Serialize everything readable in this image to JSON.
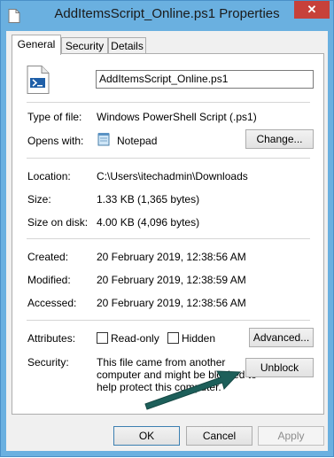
{
  "window": {
    "title": "AddItemsScript_Online.ps1 Properties",
    "close_glyph": "✕"
  },
  "tabs": [
    {
      "label": "General"
    },
    {
      "label": "Security"
    },
    {
      "label": "Details"
    }
  ],
  "file": {
    "name": "AddItemsScript_Online.ps1"
  },
  "type_of_file": {
    "label": "Type of file:",
    "value": "Windows PowerShell Script (.ps1)"
  },
  "opens_with": {
    "label": "Opens with:",
    "value": "Notepad",
    "change_button": "Change..."
  },
  "location": {
    "label": "Location:",
    "value": "C:\\Users\\itechadmin\\Downloads"
  },
  "size": {
    "label": "Size:",
    "value": "1.33 KB (1,365 bytes)"
  },
  "size_on_disk": {
    "label": "Size on disk:",
    "value": "4.00 KB (4,096 bytes)"
  },
  "created": {
    "label": "Created:",
    "value": "20 February 2019, 12:38:56 AM"
  },
  "modified": {
    "label": "Modified:",
    "value": "20 February 2019, 12:38:59 AM"
  },
  "accessed": {
    "label": "Accessed:",
    "value": "20 February 2019, 12:38:56 AM"
  },
  "attributes": {
    "label": "Attributes:",
    "readonly_label": "Read-only",
    "readonly_checked": false,
    "hidden_label": "Hidden",
    "hidden_checked": false,
    "advanced_button": "Advanced..."
  },
  "security": {
    "label": "Security:",
    "message_lines": [
      "This file came from another",
      "computer and might be blocked to",
      "help protect this computer."
    ],
    "unblock_button": "Unblock"
  },
  "footer": {
    "ok": "OK",
    "cancel": "Cancel",
    "apply": "Apply"
  },
  "colors": {
    "title_bar": "#6ab0e0",
    "close_button": "#c7413a",
    "annotation_arrow": "#1d5f5a"
  }
}
